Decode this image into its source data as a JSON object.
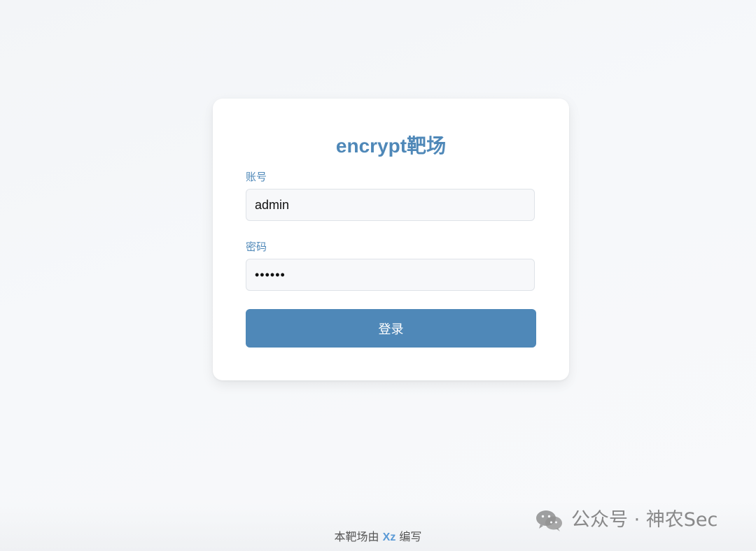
{
  "login_card": {
    "title": "encrypt靶场",
    "account_label": "账号",
    "account_value": "admin",
    "password_label": "密码",
    "password_value": "••••••",
    "login_button": "登录"
  },
  "footer": {
    "prefix": "本靶场由",
    "author": "Xz",
    "suffix": "编写"
  },
  "watermark": {
    "icon": "wechat-icon",
    "text": "公众号 · 神农Sec"
  },
  "colors": {
    "primary": "#4f88b8",
    "author_link": "#5a9ad6"
  }
}
